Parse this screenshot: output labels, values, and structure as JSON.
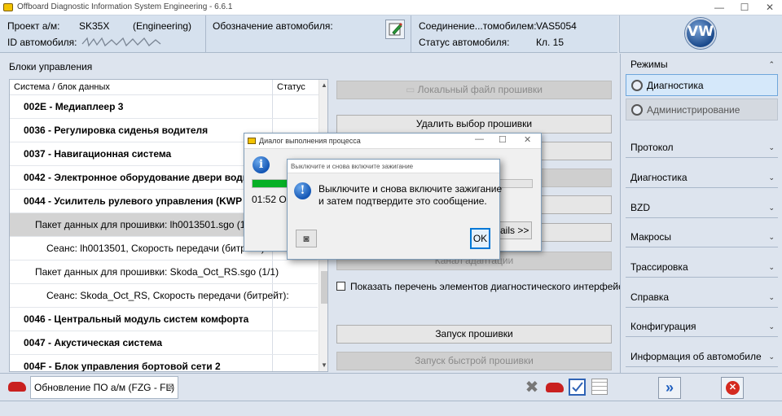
{
  "window": {
    "title": "Offboard Diagnostic Information System Engineering - 6.6.1",
    "minimize": "—",
    "maximize": "☐",
    "close": "✕"
  },
  "header": {
    "project_label": "Проект а/м:",
    "project_value": "SK35X",
    "project_mode": "(Engineering)",
    "vin_label": "ID автомобиля:",
    "vehicle_designation_label": "Обозначение автомобиля:",
    "connection_label": "Соединение...томобилем:",
    "connection_value": "VAS5054",
    "status_label": "Статус автомобиля:",
    "status_value": "Кл. 15",
    "logo_text": "VW"
  },
  "control_units": {
    "section_title": "Блоки управления",
    "col_system": "Система / блок данных",
    "col_status": "Статус",
    "rows": [
      {
        "text": "002E - Медиаплеер 3"
      },
      {
        "text": "0036 - Регулировка сиденья водителя"
      },
      {
        "text": "0037 - Навигационная система"
      },
      {
        "text": "0042 - Электронное оборудование двери води"
      },
      {
        "text": "0044 - Усилитель рулевого управления  (KWP"
      },
      {
        "text": "Пакет данных для прошивки: lh0013501.sgo (1/1)"
      },
      {
        "text": "Сеанс: lh0013501, Скорость передачи (битрейт): 0kbi"
      },
      {
        "text": "Пакет данных для прошивки: Skoda_Oct_RS.sgo (1/1)"
      },
      {
        "text": "Сеанс: Skoda_Oct_RS, Скорость передачи (битрейт):"
      },
      {
        "text": "0046 - Центральный модуль систем комфорта"
      },
      {
        "text": "0047 - Акустическая система"
      },
      {
        "text": "004F - Блок управления бортовой сети 2"
      }
    ]
  },
  "buttons": {
    "local_flash_file": "Локальный файл прошивки",
    "deselect_flash": "Удалить выбор прошивки",
    "details": "ails >>",
    "adaptation_channel": "Канал адаптации",
    "show_diag_interface": "Показать перечень элементов диагностического интерфейса",
    "start_flash": "Запуск прошивки",
    "start_quick_flash": "Запуск быстрой прошивки"
  },
  "right_panel": {
    "modes_title": "Режимы",
    "mode_diagnostics": "Диагностика",
    "mode_admin": "Администрирование",
    "sections": [
      "Протокол",
      "Диагностика",
      "BZD",
      "Макросы",
      "Трассировка",
      "Справка",
      "Конфигурация",
      "Информация об автомобиле"
    ]
  },
  "bottom": {
    "tab_label": "Обновление ПО а/м (FZG - FL)",
    "tab_close": "⊠"
  },
  "process_dialog": {
    "title": "Диалог выполнения процесса",
    "time": "01:52",
    "time_suffix": "O"
  },
  "ignition_dialog": {
    "title": "Выключите и снова включите зажигание",
    "message_line1": "Выключите и снова включите зажигание",
    "message_line2": "и затем подтвердите это сообщение.",
    "ok": "OK"
  },
  "colors": {
    "progress_green": "#06b025",
    "active_mode_bg": "#d5e8fa",
    "cancel_red": "#d42a1f",
    "forward_blue": "#1f5fbf"
  }
}
